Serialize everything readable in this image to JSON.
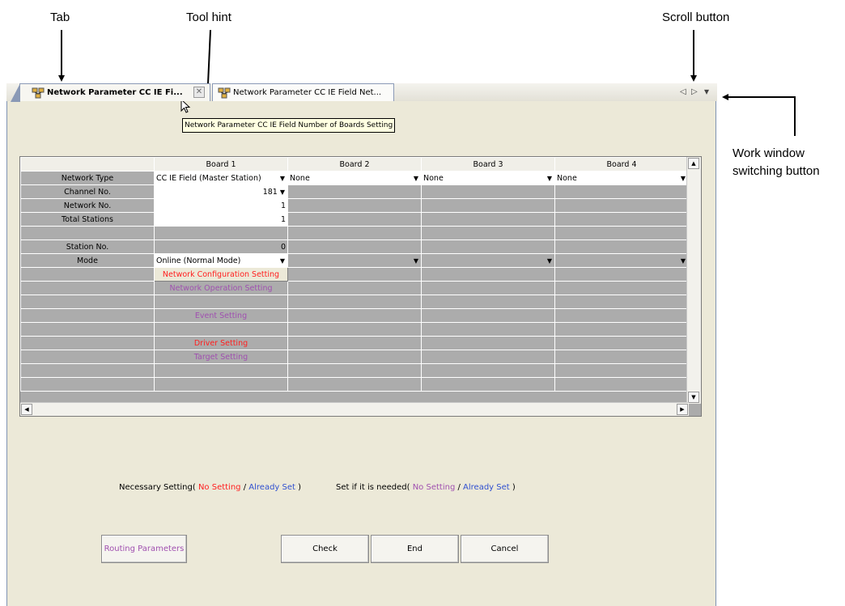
{
  "callouts": {
    "tab": "Tab",
    "tool_hint": "Tool hint",
    "scroll_button": "Scroll button",
    "work_window_line1": "Work window",
    "work_window_line2": "switching button"
  },
  "tabs": [
    {
      "label": "Network Parameter CC IE Fi...",
      "active": true,
      "close": "✕"
    },
    {
      "label": "Network Parameter CC IE Field Net...",
      "active": false
    }
  ],
  "tab_controls": {
    "scroll_left": "◁",
    "scroll_right": "▷",
    "menu": "▾"
  },
  "tooltip": "Network Parameter CC IE Field Number of Boards Setting",
  "grid": {
    "headers": [
      "",
      "Board 1",
      "Board 2",
      "Board 3",
      "Board 4"
    ],
    "rows": {
      "network_type": {
        "label": "Network Type",
        "b1": "CC IE Field (Master Station)",
        "b2": "None",
        "b3": "None",
        "b4": "None"
      },
      "channel_no": {
        "label": "Channel No.",
        "b1": "181"
      },
      "network_no": {
        "label": "Network No.",
        "b1": "1"
      },
      "total_stations": {
        "label": "Total Stations",
        "b1": "1"
      },
      "station_no": {
        "label": "Station No.",
        "b1": "0"
      },
      "mode": {
        "label": "Mode",
        "b1": "Online (Normal Mode)"
      }
    },
    "settings": {
      "network_configuration": "Network Configuration Setting",
      "network_operation": "Network Operation Setting",
      "event": "Event Setting",
      "driver": "Driver Setting",
      "target": "Target Setting"
    }
  },
  "legend": {
    "necessary_prefix": "Necessary Setting(",
    "no_setting": "No Setting",
    "slash": "/",
    "already_set": "Already Set",
    "close_paren": ")",
    "needed_prefix": "Set if it is needed(",
    "no_setting_2": "No Setting",
    "slash_2": "/",
    "already_set_2": "Already Set",
    "close_paren_2": ")"
  },
  "buttons": {
    "routing": "Routing Parameters",
    "check": "Check",
    "end": "End",
    "cancel": "Cancel"
  },
  "colors": {
    "required": "#ff2020",
    "set": "#3050d0",
    "optional": "#a050b0"
  }
}
